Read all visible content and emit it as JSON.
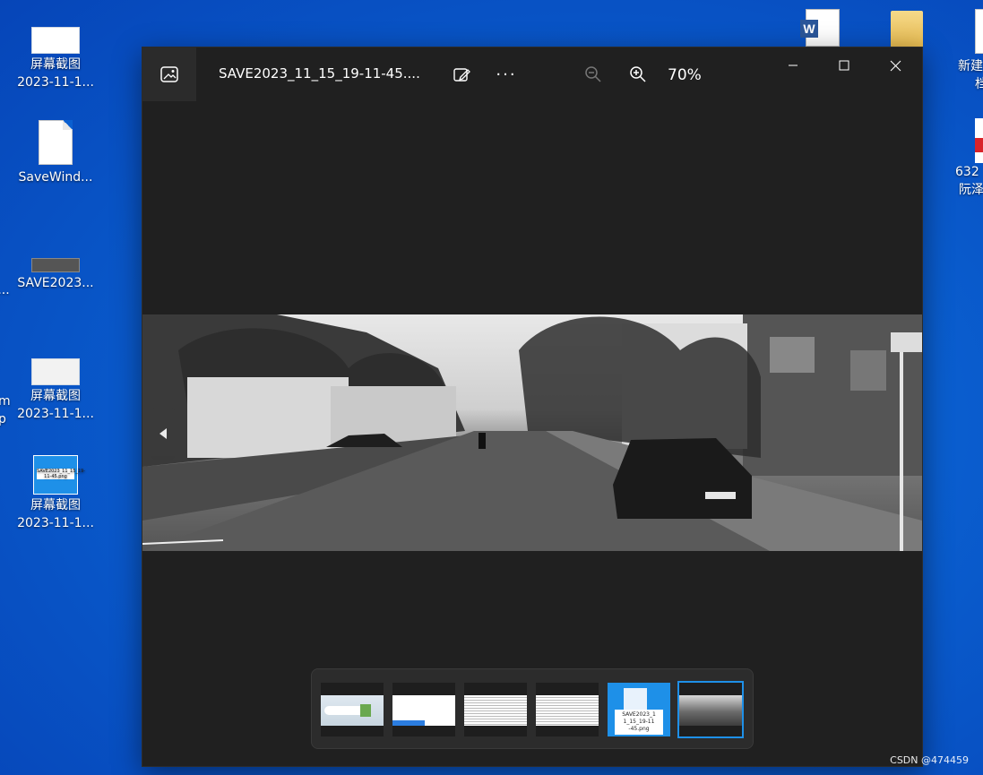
{
  "desktop": {
    "icons": [
      {
        "label_line1": "屏幕截图",
        "label_line2": "2023-11-1..."
      },
      {
        "label_line1": "SaveWind...",
        "label_line2": ""
      },
      {
        "label_line1": "SAVE2023...",
        "label_line2": ""
      },
      {
        "label_line1": "屏幕截图",
        "label_line2": "2023-11-1..."
      },
      {
        "label_line1": "屏幕截图",
        "label_line2": "2023-11-1..."
      }
    ],
    "right_icons": [
      {
        "label_line1": "新建",
        "label_line2": "档"
      },
      {
        "label_line1": "632",
        "label_line2": "阮泽"
      }
    ],
    "left_clipped": {
      "a": "m",
      "b": "p",
      "c": "..."
    },
    "file_thumb_text": "SAVE2023_11_15_19-11-45.png"
  },
  "viewer": {
    "title": "SAVE2023_11_15_19-11-45....",
    "zoom_level": "70%",
    "more_label": "···"
  },
  "filmstrip": {
    "selected_index": 5,
    "selected_file_text": "SAVE2023_1 1_15_19-11 -45.png"
  },
  "watermark": "CSDN @474459",
  "colors": {
    "accent": "#1e90e8",
    "window_bg": "#202020",
    "desktop": "#0a5fd0"
  }
}
